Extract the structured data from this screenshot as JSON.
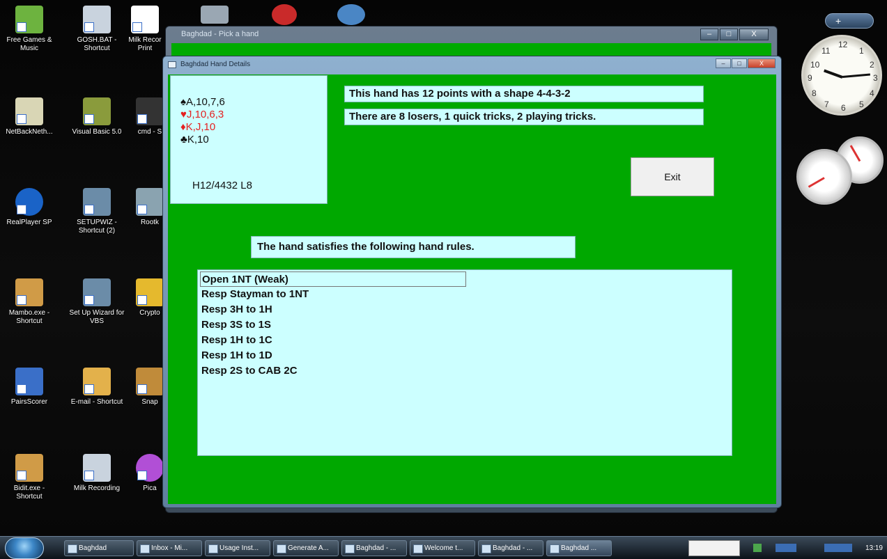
{
  "desktop": {
    "icons": [
      {
        "label": "Free Games & Music",
        "color": "#6db33f"
      },
      {
        "label": "GOSH.BAT - Shortcut",
        "color": "#c9d3de"
      },
      {
        "label": "Milk Recor Print",
        "color": "#ffffff"
      },
      {
        "label": "NetBackNeth...",
        "color": "#d9d6b5"
      },
      {
        "label": "Visual Basic 5.0",
        "color": "#8a9b3c"
      },
      {
        "label": "cmd - S",
        "color": "#333333"
      },
      {
        "label": "RealPlayer SP",
        "color": "#1a63c7"
      },
      {
        "label": "SETUPWIZ - Shortcut (2)",
        "color": "#6b8ca8"
      },
      {
        "label": "Rootk",
        "color": "#8aa3b0"
      },
      {
        "label": "Mambo.exe - Shortcut",
        "color": "#d09b47"
      },
      {
        "label": "Set Up Wizard for VBS",
        "color": "#6b8ca8"
      },
      {
        "label": "Crypto",
        "color": "#e5b92d"
      },
      {
        "label": "PairsScorer",
        "color": "#3a6fc8"
      },
      {
        "label": "E-mail - Shortcut",
        "color": "#e3b14b"
      },
      {
        "label": "Snap",
        "color": "#c08b3a"
      },
      {
        "label": "Bidit.exe - Shortcut",
        "color": "#d09b47"
      },
      {
        "label": "Milk Recording",
        "color": "#c9d3de"
      },
      {
        "label": "Pica",
        "color": "#b14fd6"
      }
    ]
  },
  "gadgets": {
    "control": "+",
    "clock_numbers": [
      "12",
      "1",
      "2",
      "3",
      "4",
      "5",
      "6",
      "7",
      "8",
      "9",
      "10",
      "11"
    ]
  },
  "background_window": {
    "title": "Baghdad - Pick a hand",
    "buttons": [
      "–",
      "□",
      "X"
    ]
  },
  "dialog": {
    "title": "Baghdad Hand Details",
    "title_buttons": [
      "–",
      "□",
      "X"
    ],
    "hand": {
      "spades": "♠A,10,7,6",
      "hearts": "♥J,10,6,3",
      "diamonds": "♦K,J,10",
      "clubs": "♣K,10",
      "summary": "H12/4432 L8"
    },
    "points_text": "This hand has 12 points with a shape 4-4-3-2",
    "losers_text": "There are 8 losers, 1 quick tricks, 2 playing tricks.",
    "exit_label": "Exit",
    "rules_heading": "The hand satisfies the following hand rules.",
    "rules": [
      "Open 1NT (Weak)",
      "Resp Stayman to 1NT",
      "Resp 3H to 1H",
      "Resp 3S to 1S",
      "Resp 1H to 1C",
      "Resp 1H to 1D",
      "Resp 2S to CAB 2C"
    ],
    "colors": {
      "client_bg": "#00a800",
      "box_bg": "#ccffff",
      "red_suit": "#e42020"
    }
  },
  "taskbar": {
    "buttons": [
      "Baghdad",
      "Inbox - Mi...",
      "Usage Inst...",
      "Generate A...",
      "Baghdad - ...",
      "Welcome t...",
      "Baghdad - ...",
      "Baghdad ..."
    ],
    "time": "13:19"
  }
}
